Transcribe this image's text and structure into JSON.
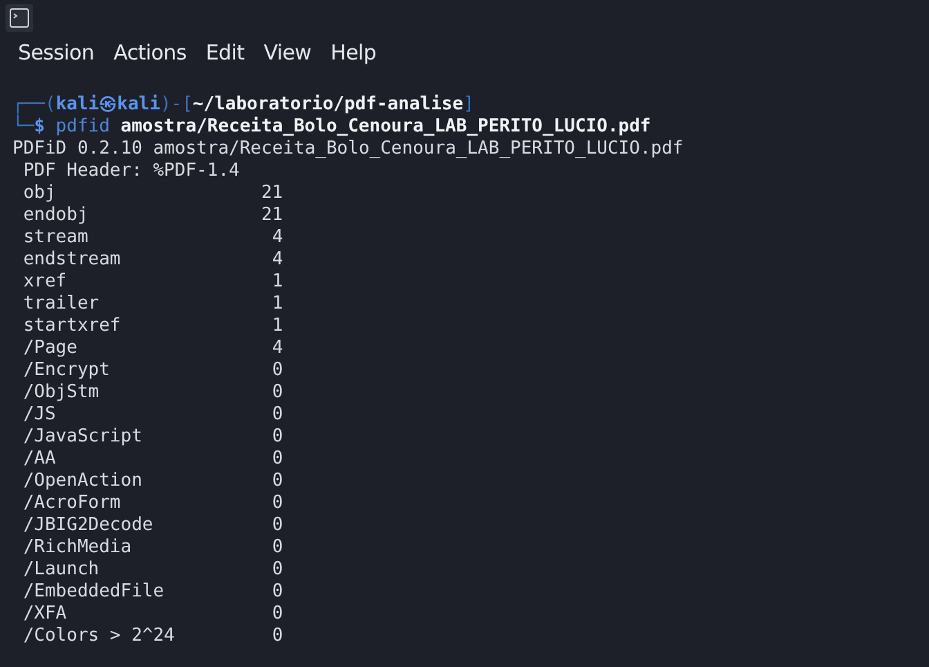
{
  "menu": [
    {
      "label": "Session"
    },
    {
      "label": "Actions"
    },
    {
      "label": "Edit"
    },
    {
      "label": "View"
    },
    {
      "label": "Help"
    }
  ],
  "terminal": {
    "prompt_lines": [
      [
        {
          "kind": "frame",
          "text": "┌──("
        },
        {
          "kind": "user",
          "text": "kali㉿kali"
        },
        {
          "kind": "frame",
          "text": ")-["
        },
        {
          "kind": "path",
          "text": "~/laboratorio/pdf-analise"
        },
        {
          "kind": "frame",
          "text": "]"
        }
      ],
      [
        {
          "kind": "frame",
          "text": "└─"
        },
        {
          "kind": "dollar",
          "text": "$"
        },
        {
          "kind": "command",
          "text": "pdfid"
        },
        {
          "kind": "argument",
          "text": "amostra/Receita_Bolo_Cenoura_LAB_PERITO_LUCIO.pdf"
        }
      ]
    ],
    "output_header": "PDFiD 0.2.10 amostra/Receita_Bolo_Cenoura_LAB_PERITO_LUCIO.pdf",
    "pdf_header": "PDF Header: %PDF-1.4",
    "counts": [
      {
        "name": "obj",
        "count": "21"
      },
      {
        "name": "endobj",
        "count": "21"
      },
      {
        "name": "stream",
        "count": "4"
      },
      {
        "name": "endstream",
        "count": "4"
      },
      {
        "name": "xref",
        "count": "1"
      },
      {
        "name": "trailer",
        "count": "1"
      },
      {
        "name": "startxref",
        "count": "1"
      },
      {
        "name": "/Page",
        "count": "4"
      },
      {
        "name": "/Encrypt",
        "count": "0"
      },
      {
        "name": "/ObjStm",
        "count": "0"
      },
      {
        "name": "/JS",
        "count": "0"
      },
      {
        "name": "/JavaScript",
        "count": "0"
      },
      {
        "name": "/AA",
        "count": "0"
      },
      {
        "name": "/OpenAction",
        "count": "0"
      },
      {
        "name": "/AcroForm",
        "count": "0"
      },
      {
        "name": "/JBIG2Decode",
        "count": "0"
      },
      {
        "name": "/RichMedia",
        "count": "0"
      },
      {
        "name": "/Launch",
        "count": "0"
      },
      {
        "name": "/EmbeddedFile",
        "count": "0"
      },
      {
        "name": "/XFA",
        "count": "0"
      },
      {
        "name": "/Colors > 2^24",
        "count": "0"
      }
    ]
  }
}
